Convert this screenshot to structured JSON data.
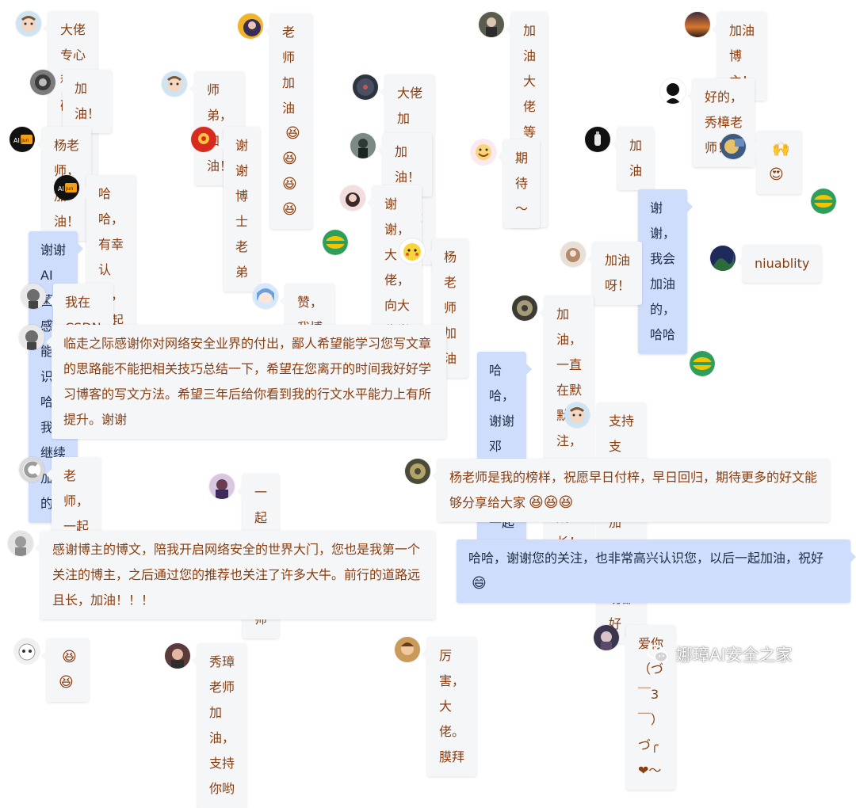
{
  "messages": [
    {
      "text": "大佬专心科研，加油！",
      "emoji": ""
    },
    {
      "text": "老师加油",
      "emoji": "😆😆😆😆"
    },
    {
      "text": "加油 大佬 等你凯旋",
      "emoji": ""
    },
    {
      "text": "加油博主！",
      "emoji": ""
    },
    {
      "text": "加油！",
      "emoji": ""
    },
    {
      "text": "师弟，加油！",
      "emoji": ""
    },
    {
      "text": "大佬加油！祝未来一切都好。",
      "emoji": ""
    },
    {
      "text": "好的，秀樟老师！！",
      "emoji": ""
    },
    {
      "text": "杨老师，加油！",
      "emoji": ""
    },
    {
      "text": "谢谢博士老弟",
      "emoji": ""
    },
    {
      "text": "加油！",
      "emoji": ""
    },
    {
      "text": "期待～",
      "emoji": ""
    },
    {
      "text": "加油",
      "emoji": ""
    },
    {
      "text": "",
      "emoji": "🙌😍"
    },
    {
      "text": "哈哈，有幸认识，一起加油！",
      "emoji": ""
    },
    {
      "text": "谢谢，大佬，向大佬学习",
      "emoji": ""
    },
    {
      "text": "谢谢，我会加油的，哈哈",
      "emoji": ""
    },
    {
      "text": "谢谢AI菌，感谢能认识，哈哈 我会继续加油的",
      "emoji": ""
    },
    {
      "text": "杨老师 加油",
      "emoji": ""
    },
    {
      "text": "加油呀！",
      "emoji": ""
    },
    {
      "text": "niuablity",
      "emoji": ""
    },
    {
      "text": "我在CSDN等着您回来。",
      "emoji": ""
    },
    {
      "text": "赞，我博三，一起加油",
      "emoji": ""
    },
    {
      "text": "加油，一直在默默关注，见证，成长！",
      "emoji": ""
    },
    {
      "text": "临走之际感谢你对网络安全业界的付出，鄙人希望能学习您写文章的思路能不能把相关技巧总结一下，希望在您离开的时间我好好学习博客的写文方法。希望三年后给你看到我的行文水平能力上有所提升。谢谢",
      "emoji": ""
    },
    {
      "text": "哈哈，谢谢邓兄，以后一起加油",
      "emoji": ""
    },
    {
      "text": "支持支持，加油加油，祝一切都好",
      "emoji": ""
    },
    {
      "text": "老师，一起加油",
      "emoji": ""
    },
    {
      "text": "一起加油 老师",
      "emoji": ""
    },
    {
      "text": "杨老师是我的榜样，祝愿早日付梓，早日回归，期待更多的好文能够分享给大家",
      "emoji": "😆😆😆"
    },
    {
      "text": "感谢博主的博文，陪我开启网络安全的世界大门，您也是我第一个关注的博主，之后通过您的推荐也关注了许多大牛。前行的道路远且长，加油！！！",
      "emoji": ""
    },
    {
      "text": "哈哈，谢谢您的关注，也非常高兴认识您，以后一起加油，祝好",
      "emoji": "😄"
    },
    {
      "text": "",
      "emoji": "😆😆"
    },
    {
      "text": "秀璋老师加油，支持你哟",
      "emoji": ""
    },
    {
      "text": "厉害，大佬。膜拜",
      "emoji": ""
    },
    {
      "text": "爱你（づ￣3￣）づ╭❤～",
      "emoji": ""
    }
  ],
  "watermark": {
    "text": "娜璋AI安全之家",
    "icon": "wechat-icon"
  },
  "colors": {
    "bubble_left_bg": "#f5f6f8",
    "bubble_left_text": "#8a3e0f",
    "bubble_right_bg": "#cfddfd",
    "bubble_right_text": "#1f2c44",
    "author_avatar": "#2f9e5c"
  }
}
